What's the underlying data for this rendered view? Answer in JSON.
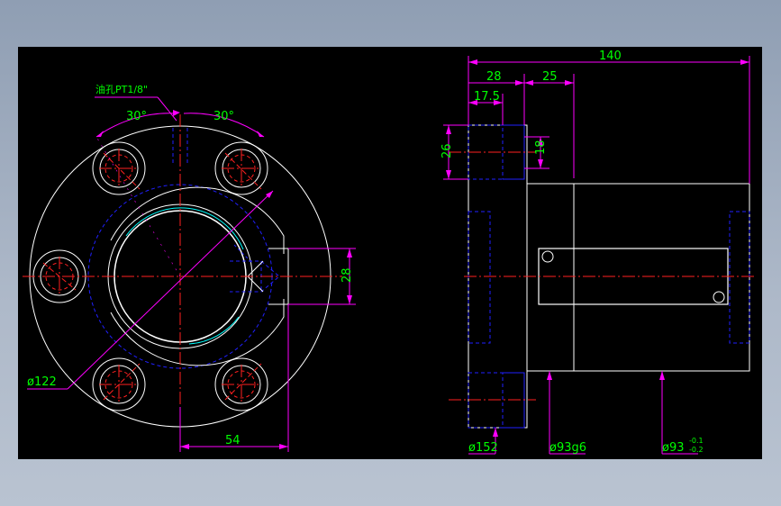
{
  "colors": {
    "background": "#000000",
    "outline": "#ffffff",
    "hidden": "#2020ff",
    "centerline": "#ff2020",
    "dimension": "#00ff00",
    "extension": "#ff00ff",
    "accent": "#00ffff"
  },
  "front_view": {
    "oil_hole_label": "油孔PT1/8\"",
    "angle_left": "30°",
    "angle_right": "30°",
    "dim_pcd": "ø122",
    "dim_54": "54",
    "dim_28": "28"
  },
  "side_view": {
    "dim_140": "140",
    "dim_28": "28",
    "dim_25": "25",
    "dim_17_5": "17.5",
    "dim_26": "26",
    "dim_18": "18",
    "dim_d152": "ø152",
    "dim_d93g6": "ø93g6",
    "dim_d93": "ø93",
    "tol_upper": "-0.1",
    "tol_lower": "-0.2"
  }
}
